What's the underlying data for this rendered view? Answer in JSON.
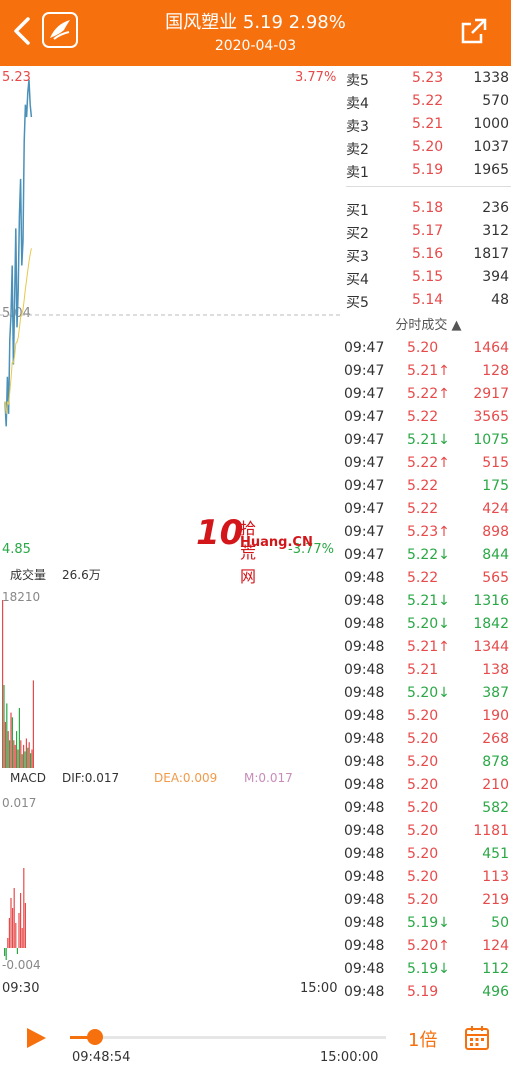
{
  "header": {
    "title": "国风塑业  5.19  2.98%",
    "date": "2020-04-03"
  },
  "chart": {
    "price_high": "5.23",
    "pct_high": "3.77%",
    "price_mid": "5.04",
    "price_low": "4.85",
    "pct_low": "-3.77%",
    "volume_label": "成交量",
    "volume_value": "26.6万",
    "volume_max": "18210",
    "macd_label": "MACD",
    "dif": "DIF:0.017",
    "dea": "DEA:0.009",
    "m": "M:0.017",
    "macd_top": "0.017",
    "macd_bottom": "-0.004",
    "time_start": "09:30",
    "time_end": "15:00"
  },
  "orderbook": {
    "asks": [
      {
        "label": "卖5",
        "price": "5.23",
        "vol": "1338"
      },
      {
        "label": "卖4",
        "price": "5.22",
        "vol": "570"
      },
      {
        "label": "卖3",
        "price": "5.21",
        "vol": "1000"
      },
      {
        "label": "卖2",
        "price": "5.20",
        "vol": "1037"
      },
      {
        "label": "卖1",
        "price": "5.19",
        "vol": "1965"
      }
    ],
    "bids": [
      {
        "label": "买1",
        "price": "5.18",
        "vol": "236"
      },
      {
        "label": "买2",
        "price": "5.17",
        "vol": "312"
      },
      {
        "label": "买3",
        "price": "5.16",
        "vol": "1817"
      },
      {
        "label": "买4",
        "price": "5.15",
        "vol": "394"
      },
      {
        "label": "买5",
        "price": "5.14",
        "vol": "48"
      }
    ]
  },
  "trades_header": "分时成交 ▲",
  "trades": [
    {
      "time": "09:47",
      "price": "5.20",
      "vol": "1464",
      "dir": "red"
    },
    {
      "time": "09:47",
      "price": "5.21↑",
      "vol": "128",
      "dir": "red"
    },
    {
      "time": "09:47",
      "price": "5.22↑",
      "vol": "2917",
      "dir": "red"
    },
    {
      "time": "09:47",
      "price": "5.22",
      "vol": "3565",
      "dir": "red"
    },
    {
      "time": "09:47",
      "price": "5.21↓",
      "vol": "1075",
      "dir": "green"
    },
    {
      "time": "09:47",
      "price": "5.22↑",
      "vol": "515",
      "dir": "red"
    },
    {
      "time": "09:47",
      "price": "5.22",
      "vol": "175",
      "dir": "green"
    },
    {
      "time": "09:47",
      "price": "5.22",
      "vol": "424",
      "dir": "red"
    },
    {
      "time": "09:47",
      "price": "5.23↑",
      "vol": "898",
      "dir": "red"
    },
    {
      "time": "09:47",
      "price": "5.22↓",
      "vol": "844",
      "dir": "green"
    },
    {
      "time": "09:48",
      "price": "5.22",
      "vol": "565",
      "dir": "red"
    },
    {
      "time": "09:48",
      "price": "5.21↓",
      "vol": "1316",
      "dir": "green"
    },
    {
      "time": "09:48",
      "price": "5.20↓",
      "vol": "1842",
      "dir": "green"
    },
    {
      "time": "09:48",
      "price": "5.21↑",
      "vol": "1344",
      "dir": "red"
    },
    {
      "time": "09:48",
      "price": "5.21",
      "vol": "138",
      "dir": "red"
    },
    {
      "time": "09:48",
      "price": "5.20↓",
      "vol": "387",
      "dir": "green"
    },
    {
      "time": "09:48",
      "price": "5.20",
      "vol": "190",
      "dir": "red"
    },
    {
      "time": "09:48",
      "price": "5.20",
      "vol": "268",
      "dir": "red"
    },
    {
      "time": "09:48",
      "price": "5.20",
      "vol": "878",
      "dir": "green"
    },
    {
      "time": "09:48",
      "price": "5.20",
      "vol": "210",
      "dir": "red"
    },
    {
      "time": "09:48",
      "price": "5.20",
      "vol": "582",
      "dir": "green"
    },
    {
      "time": "09:48",
      "price": "5.20",
      "vol": "1181",
      "dir": "red"
    },
    {
      "time": "09:48",
      "price": "5.20",
      "vol": "451",
      "dir": "green"
    },
    {
      "time": "09:48",
      "price": "5.20",
      "vol": "113",
      "dir": "red"
    },
    {
      "time": "09:48",
      "price": "5.20",
      "vol": "219",
      "dir": "red"
    },
    {
      "time": "09:48",
      "price": "5.19↓",
      "vol": "50",
      "dir": "green"
    },
    {
      "time": "09:48",
      "price": "5.20↑",
      "vol": "124",
      "dir": "red"
    },
    {
      "time": "09:48",
      "price": "5.19↓",
      "vol": "112",
      "dir": "green"
    },
    {
      "time": "09:48",
      "price": "5.19",
      "vol": "496",
      "dir": "green"
    }
  ],
  "watermark": {
    "num": "10",
    "cn": "拾荒网",
    "en": "Huang.CN"
  },
  "playback": {
    "current_time": "09:48:54",
    "end_time": "15:00:00",
    "progress": 0.08,
    "speed": "1倍"
  },
  "colors": {
    "accent": "#f7700e",
    "up": "#e74a4a",
    "down": "#2aa846"
  },
  "chart_data": {
    "type": "line",
    "series": [
      {
        "values": [
          4.97,
          4.95,
          4.99,
          4.96,
          5.02,
          5.04,
          5.08,
          5.0,
          5.05,
          5.11,
          5.03,
          5.06,
          5.12,
          5.15,
          5.08,
          5.1,
          5.18,
          5.21,
          5.2,
          5.22,
          5.23,
          5.21,
          5.2
        ]
      }
    ],
    "ylim": [
      4.85,
      5.23
    ],
    "volume": [
      18210,
      9000,
      5000,
      7000,
      4000,
      3000,
      6000,
      5500,
      3000,
      2500,
      4000,
      2000,
      6500,
      3000,
      1500,
      2500,
      1800,
      3200,
      2200,
      2800,
      1600,
      2000,
      9500
    ],
    "volume_dir": [
      "red",
      "green",
      "red",
      "green",
      "red",
      "green",
      "red",
      "green",
      "red",
      "red",
      "green",
      "red",
      "green",
      "red",
      "green",
      "red",
      "green",
      "red",
      "green",
      "red",
      "green",
      "red",
      "red"
    ]
  }
}
